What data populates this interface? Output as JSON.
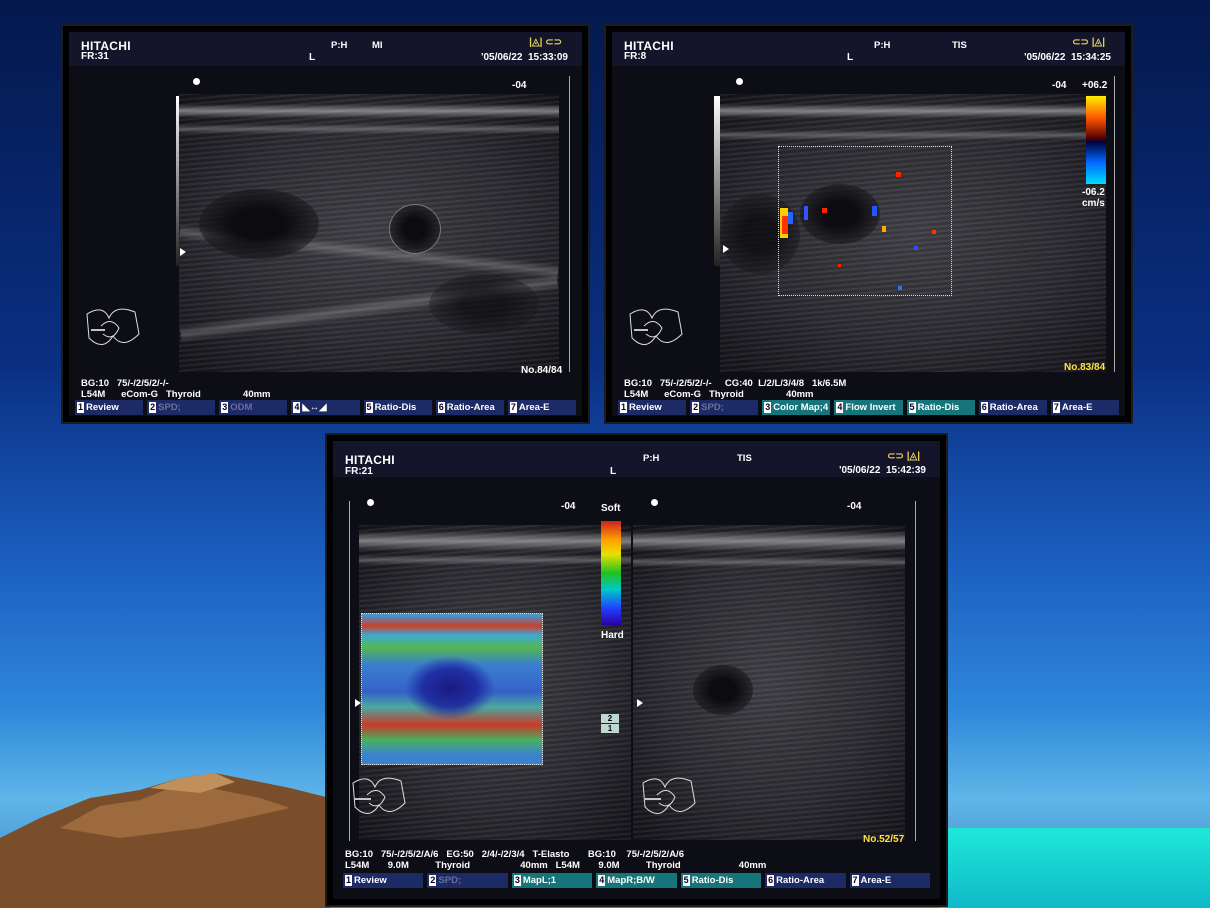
{
  "p1": {
    "brand": "HITACHI",
    "fr": "FR:31",
    "ph": "P:H",
    "mode": "MI",
    "side": "L",
    "date": "'05/06/22",
    "time": "15:33:09",
    "icons": "|◬| ⊂⊃",
    "depth": "-04",
    "count": "No.84/84",
    "info1": "BG:10   75/-/2/5/2/-/-",
    "info2": "L54M      eCom-G   Thyroid                40mm",
    "buttons": [
      {
        "n": "1",
        "label": "Review"
      },
      {
        "n": "2",
        "label": "SPD;"
      },
      {
        "n": "3",
        "label": "ODM"
      },
      {
        "n": "4",
        "label": "◣↔◢"
      },
      {
        "n": "5",
        "label": "Ratio-Dis"
      },
      {
        "n": "6",
        "label": "Ratio-Area"
      },
      {
        "n": "7",
        "label": "Area-E"
      }
    ]
  },
  "p2": {
    "brand": "HITACHI",
    "fr": "FR:8",
    "ph": "P:H",
    "mode": "TIS",
    "side": "L",
    "date": "'05/06/22",
    "time": "15:34:25",
    "icons": "⊂⊃ |◬|",
    "depth": "-04",
    "vmax": "+06.2",
    "vmin": "-06.2",
    "unit": "cm/s",
    "count": "No.83/84",
    "info1": "BG:10   75/-/2/5/2/-/-     CG:40  L/2/L/3/4/8   1k/6.5M",
    "info2": "L54M      eCom-G   Thyroid                40mm",
    "buttons": [
      {
        "n": "1",
        "label": "Review"
      },
      {
        "n": "2",
        "label": "SPD;"
      },
      {
        "n": "3",
        "label": "Color Map;4"
      },
      {
        "n": "4",
        "label": "Flow Invert"
      },
      {
        "n": "5",
        "label": "Ratio-Dis"
      },
      {
        "n": "6",
        "label": "Ratio-Area"
      },
      {
        "n": "7",
        "label": "Area-E"
      }
    ]
  },
  "p3": {
    "brand": "HITACHI",
    "fr": "FR:21",
    "ph": "P:H",
    "mode": "TIS",
    "side": "L",
    "date": "'05/06/22",
    "time": "15:42:39",
    "icons": "⊂⊃ |◬|",
    "depth_left": "-04",
    "depth_right": "-04",
    "soft": "Soft",
    "hard": "Hard",
    "box2": "2",
    "box1": "1",
    "count": "No.52/57",
    "info1": "BG:10   75/-/2/5/2/A/6   EG:50   2/4/-/2/3/4   T-Elasto       BG:10    75/-/2/5/2/A/6",
    "info2": "L54M       9.0M          Thyroid                   40mm   L54M       9.0M          Thyroid                      40mm",
    "buttons": [
      {
        "n": "1",
        "label": "Review"
      },
      {
        "n": "2",
        "label": "SPD;"
      },
      {
        "n": "3",
        "label": "MapL;1"
      },
      {
        "n": "4",
        "label": "MapR;B/W"
      },
      {
        "n": "5",
        "label": "Ratio-Dis"
      },
      {
        "n": "6",
        "label": "Ratio-Area"
      },
      {
        "n": "7",
        "label": "Area-E"
      }
    ]
  }
}
